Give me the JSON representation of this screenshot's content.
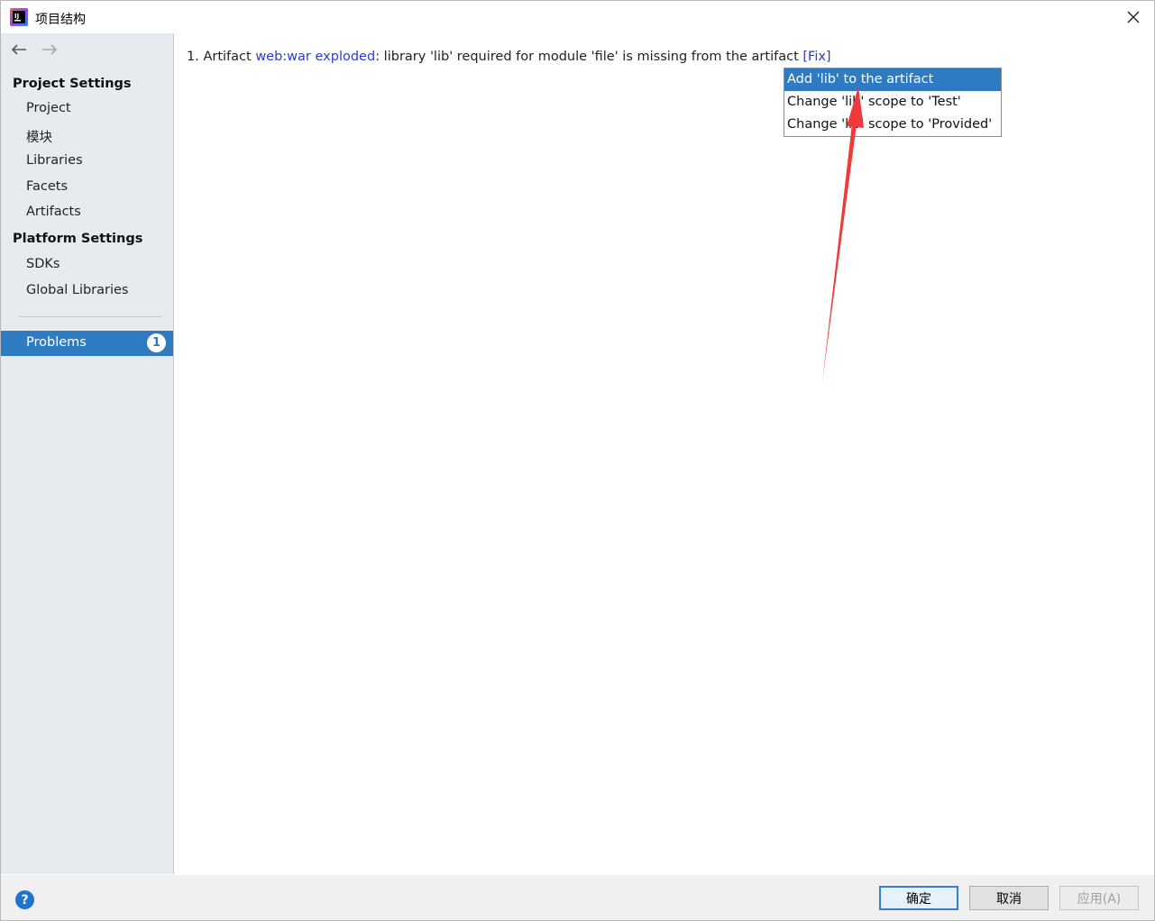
{
  "window": {
    "title": "项目结构"
  },
  "sidebar": {
    "project_settings_heading": "Project Settings",
    "project_items": [
      {
        "label": "Project"
      },
      {
        "label": "模块"
      },
      {
        "label": "Libraries"
      },
      {
        "label": "Facets"
      },
      {
        "label": "Artifacts"
      }
    ],
    "platform_settings_heading": "Platform Settings",
    "platform_items": [
      {
        "label": "SDKs"
      },
      {
        "label": "Global Libraries"
      }
    ],
    "problems": {
      "label": "Problems",
      "count": "1"
    }
  },
  "problem": {
    "number": "1.",
    "prefix": "Artifact",
    "artifact_name": "web:war exploded",
    "message": ": library 'lib' required for module 'file' is missing from the artifact",
    "fix_label": "[Fix]"
  },
  "fix_popup": {
    "options": [
      {
        "label": "Add 'lib' to the artifact",
        "selected": true
      },
      {
        "label": "Change 'lib' scope to 'Test'",
        "selected": false
      },
      {
        "label": "Change 'lib' scope to 'Provided'",
        "selected": false
      }
    ]
  },
  "buttons": {
    "ok": "确定",
    "cancel": "取消",
    "apply": "应用(A)",
    "help": "?"
  },
  "colors": {
    "accent": "#2f7bc1",
    "link": "#2a3ccf",
    "annotation_arrow": "#f03a3a"
  }
}
